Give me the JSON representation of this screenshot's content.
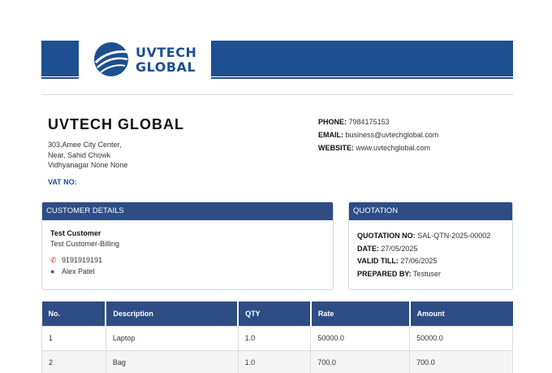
{
  "brand": {
    "line1": "UVTECH",
    "line2": "GLOBAL"
  },
  "company": {
    "name": "UVTECH GLOBAL",
    "address_lines": [
      "303,Amee City Center,",
      "Near, Sahid Chowk",
      "Vidhyanagar None None"
    ],
    "vat_label": "VAT NO:"
  },
  "contact": {
    "phone_label": "PHONE:",
    "phone": "7984175153",
    "email_label": "EMAIL:",
    "email": "business@uvtechglobal.com",
    "website_label": "WEBSITE:",
    "website": "www.uvtechglobal.com"
  },
  "customer": {
    "title": "CUSTOMER DETAILS",
    "name": "Test Customer",
    "billing": "Test Customer-Billing",
    "phone": "9191919191",
    "contact_person": "Alex Patel"
  },
  "quotation": {
    "title": "QUOTATION",
    "no_label": "QUOTATION NO:",
    "no": "SAL-QTN-2025-00002",
    "date_label": "DATE:",
    "date": "27/05/2025",
    "valid_label": "VALID TILL:",
    "valid": "27/06/2025",
    "prepared_label": "PREPARED BY:",
    "prepared": "Testuser"
  },
  "items_table": {
    "headers": [
      "No.",
      "Description",
      "QTY",
      "Rate",
      "Amount"
    ],
    "rows": [
      [
        "1",
        "Laptop",
        "1.0",
        "50000.0",
        "50000.0"
      ],
      [
        "2",
        "Bag",
        "1.0",
        "700.0",
        "700.0"
      ]
    ]
  },
  "colors": {
    "brand_blue": "#1d4f91",
    "header_blue": "#2d4d84",
    "phone_icon": "#d0342c",
    "person_icon": "#6a3aa0"
  },
  "icons": {
    "phone": "phone-icon",
    "person": "person-icon",
    "logo": "globe-logo-icon"
  }
}
